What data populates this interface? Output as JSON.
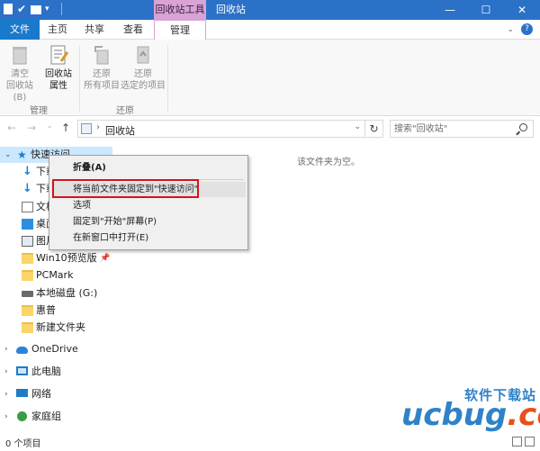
{
  "titlebar": {
    "contextual_tab": "回收站工具",
    "title": "回收站",
    "minimize": "—",
    "maximize": "☐",
    "close": "✕"
  },
  "ribbon_tabs": [
    "文件",
    "主页",
    "共享",
    "查看",
    "管理"
  ],
  "ribbon_help": {
    "collapse": "⌄",
    "help": "?"
  },
  "ribbon": {
    "buttons": [
      {
        "line1": "清空",
        "line2": "回收站(B)"
      },
      {
        "line1": "回收站",
        "line2": "属性"
      },
      {
        "line1": "还原",
        "line2": "所有项目"
      },
      {
        "line1": "还原",
        "line2": "选定的项目"
      }
    ],
    "groups": [
      "管理",
      "还原"
    ]
  },
  "nav_buttons": {
    "back": "←",
    "forward": "→",
    "recent": "⌄",
    "up": "↑"
  },
  "address": {
    "separator": "›",
    "location": "回收站",
    "dropdown": "⌄",
    "refresh": "↻",
    "search_placeholder": "搜索\"回收站\""
  },
  "navpane": {
    "items": [
      {
        "label": "快速访问",
        "expand": "⌄"
      },
      {
        "label": "下载"
      },
      {
        "label": "下载"
      },
      {
        "label": "文档"
      },
      {
        "label": "桌面"
      },
      {
        "label": "图片"
      },
      {
        "label": "Win10预览版",
        "pin": "📌"
      },
      {
        "label": "PCMark"
      },
      {
        "label": "本地磁盘 (G:)"
      },
      {
        "label": "惠普"
      },
      {
        "label": "新建文件夹"
      },
      {
        "label": "OneDrive",
        "expand": "›"
      },
      {
        "label": "此电脑",
        "expand": "›"
      },
      {
        "label": "网络",
        "expand": "›"
      },
      {
        "label": "家庭组",
        "expand": "›"
      }
    ]
  },
  "content": {
    "empty_message": "该文件夹为空。"
  },
  "context_menu": {
    "items": [
      "折叠(A)",
      "将当前文件夹固定到\"快速访问\"",
      "选项",
      "固定到\"开始\"屏幕(P)",
      "在新窗口中打开(E)"
    ]
  },
  "status": {
    "item_count": "0 个项目"
  },
  "watermark": {
    "top": "软件下载站",
    "brand": "ucbug.cc"
  },
  "colors": {
    "titlebar": "#2b71c7",
    "context_tab": "#d9a3d6",
    "highlight_box": "#d2141c",
    "selection": "#cce8ff"
  }
}
